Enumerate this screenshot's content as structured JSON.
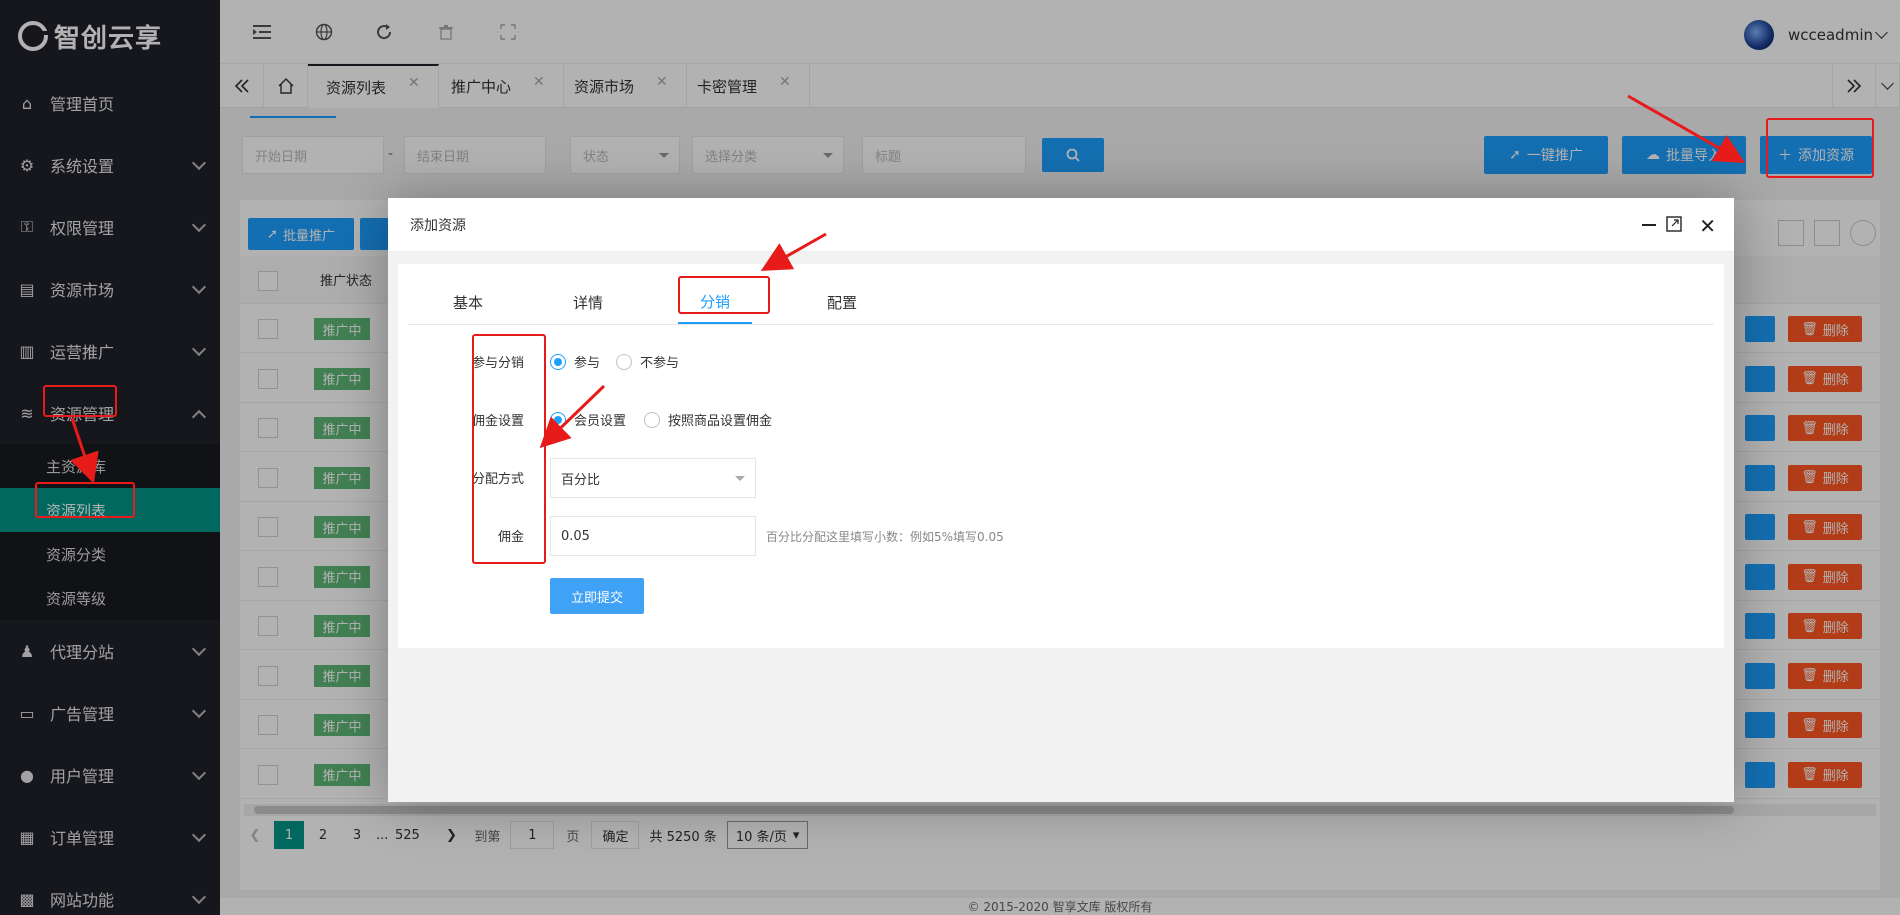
{
  "app": {
    "logo_text": "智创云享"
  },
  "sidebar": {
    "items": [
      {
        "label": "管理首页",
        "icon": "home-icon"
      },
      {
        "label": "系统设置",
        "icon": "gear-icon"
      },
      {
        "label": "权限管理",
        "icon": "user-lock-icon"
      },
      {
        "label": "资源市场",
        "icon": "store-icon"
      },
      {
        "label": "运营推广",
        "icon": "promo-icon"
      },
      {
        "label": "资源管理",
        "icon": "layers-icon"
      },
      {
        "label": "代理分站",
        "icon": "agent-icon"
      },
      {
        "label": "广告管理",
        "icon": "ad-icon"
      },
      {
        "label": "用户管理",
        "icon": "user-icon"
      },
      {
        "label": "订单管理",
        "icon": "order-icon"
      },
      {
        "label": "网站功能",
        "icon": "grid-icon"
      }
    ],
    "sub_items": [
      "主资源库",
      "资源列表",
      "资源分类",
      "资源等级"
    ]
  },
  "topbar": {
    "username": "wcceadmin"
  },
  "tabs": [
    "资源列表",
    "推广中心",
    "资源市场",
    "卡密管理"
  ],
  "filters": {
    "start_date": "开始日期",
    "end_date": "结束日期",
    "status": "状态",
    "category": "选择分类",
    "title": "标题",
    "dash": "-"
  },
  "actions": {
    "one_click_promote": "一键推广",
    "batch_import": "批量导入",
    "add_resource": "添加资源",
    "batch_promote": "批量推广"
  },
  "table": {
    "header_status": "推广状态",
    "row_badge": "推广中",
    "delete_label": "删除",
    "row_count": 10
  },
  "pagination": {
    "pages": [
      "1",
      "2",
      "3",
      "...",
      "525"
    ],
    "goto_label": "到第",
    "goto_value": "1",
    "page_unit": "页",
    "confirm": "确定",
    "total": "共 5250 条",
    "page_size": "10 条/页"
  },
  "modal": {
    "title": "添加资源",
    "tabs": [
      "基本",
      "详情",
      "分销",
      "配置"
    ],
    "active_tab": "分销",
    "fields": {
      "participate_label": "参与分销",
      "participate_yes": "参与",
      "participate_no": "不参与",
      "commission_label": "佣金设置",
      "commission_member": "会员设置",
      "commission_by_product": "按照商品设置佣金",
      "method_label": "分配方式",
      "method_value": "百分比",
      "rate_label": "佣金",
      "rate_value": "0.05",
      "rate_hint": "百分比分配这里填写小数：例如5%填写0.05"
    },
    "submit": "立即提交"
  },
  "footer": {
    "text": "© 2015-2020 智享文库 版权所有"
  },
  "colors": {
    "sidebar_bg": "#20222a",
    "accent_teal": "#009688",
    "primary_blue": "#1e9fff",
    "badge_green": "#5fb878",
    "danger": "#ff5722",
    "annotation_red": "#e81b1b"
  }
}
